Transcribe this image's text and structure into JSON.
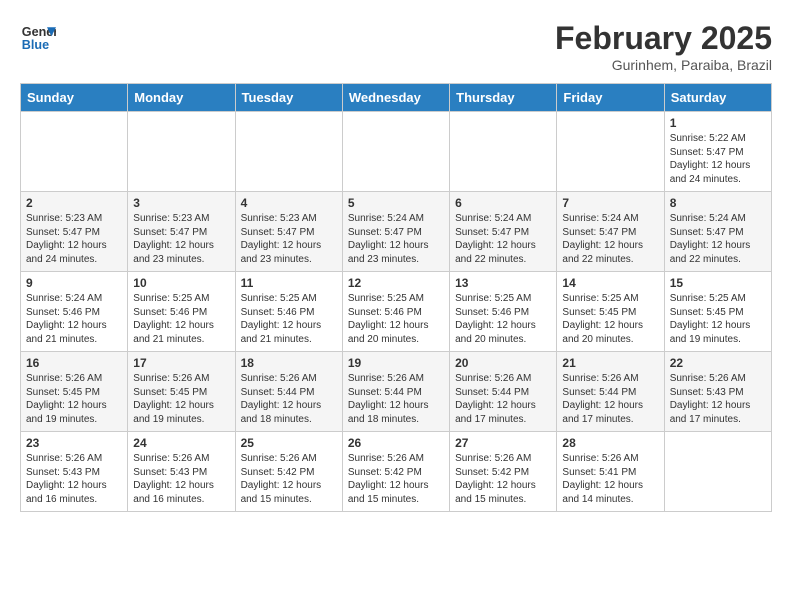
{
  "header": {
    "logo_general": "General",
    "logo_blue": "Blue",
    "month_title": "February 2025",
    "subtitle": "Gurinhem, Paraiba, Brazil"
  },
  "weekdays": [
    "Sunday",
    "Monday",
    "Tuesday",
    "Wednesday",
    "Thursday",
    "Friday",
    "Saturday"
  ],
  "weeks": [
    [
      {
        "day": "",
        "info": ""
      },
      {
        "day": "",
        "info": ""
      },
      {
        "day": "",
        "info": ""
      },
      {
        "day": "",
        "info": ""
      },
      {
        "day": "",
        "info": ""
      },
      {
        "day": "",
        "info": ""
      },
      {
        "day": "1",
        "info": "Sunrise: 5:22 AM\nSunset: 5:47 PM\nDaylight: 12 hours\nand 24 minutes."
      }
    ],
    [
      {
        "day": "2",
        "info": "Sunrise: 5:23 AM\nSunset: 5:47 PM\nDaylight: 12 hours\nand 24 minutes."
      },
      {
        "day": "3",
        "info": "Sunrise: 5:23 AM\nSunset: 5:47 PM\nDaylight: 12 hours\nand 23 minutes."
      },
      {
        "day": "4",
        "info": "Sunrise: 5:23 AM\nSunset: 5:47 PM\nDaylight: 12 hours\nand 23 minutes."
      },
      {
        "day": "5",
        "info": "Sunrise: 5:24 AM\nSunset: 5:47 PM\nDaylight: 12 hours\nand 23 minutes."
      },
      {
        "day": "6",
        "info": "Sunrise: 5:24 AM\nSunset: 5:47 PM\nDaylight: 12 hours\nand 22 minutes."
      },
      {
        "day": "7",
        "info": "Sunrise: 5:24 AM\nSunset: 5:47 PM\nDaylight: 12 hours\nand 22 minutes."
      },
      {
        "day": "8",
        "info": "Sunrise: 5:24 AM\nSunset: 5:47 PM\nDaylight: 12 hours\nand 22 minutes."
      }
    ],
    [
      {
        "day": "9",
        "info": "Sunrise: 5:24 AM\nSunset: 5:46 PM\nDaylight: 12 hours\nand 21 minutes."
      },
      {
        "day": "10",
        "info": "Sunrise: 5:25 AM\nSunset: 5:46 PM\nDaylight: 12 hours\nand 21 minutes."
      },
      {
        "day": "11",
        "info": "Sunrise: 5:25 AM\nSunset: 5:46 PM\nDaylight: 12 hours\nand 21 minutes."
      },
      {
        "day": "12",
        "info": "Sunrise: 5:25 AM\nSunset: 5:46 PM\nDaylight: 12 hours\nand 20 minutes."
      },
      {
        "day": "13",
        "info": "Sunrise: 5:25 AM\nSunset: 5:46 PM\nDaylight: 12 hours\nand 20 minutes."
      },
      {
        "day": "14",
        "info": "Sunrise: 5:25 AM\nSunset: 5:45 PM\nDaylight: 12 hours\nand 20 minutes."
      },
      {
        "day": "15",
        "info": "Sunrise: 5:25 AM\nSunset: 5:45 PM\nDaylight: 12 hours\nand 19 minutes."
      }
    ],
    [
      {
        "day": "16",
        "info": "Sunrise: 5:26 AM\nSunset: 5:45 PM\nDaylight: 12 hours\nand 19 minutes."
      },
      {
        "day": "17",
        "info": "Sunrise: 5:26 AM\nSunset: 5:45 PM\nDaylight: 12 hours\nand 19 minutes."
      },
      {
        "day": "18",
        "info": "Sunrise: 5:26 AM\nSunset: 5:44 PM\nDaylight: 12 hours\nand 18 minutes."
      },
      {
        "day": "19",
        "info": "Sunrise: 5:26 AM\nSunset: 5:44 PM\nDaylight: 12 hours\nand 18 minutes."
      },
      {
        "day": "20",
        "info": "Sunrise: 5:26 AM\nSunset: 5:44 PM\nDaylight: 12 hours\nand 17 minutes."
      },
      {
        "day": "21",
        "info": "Sunrise: 5:26 AM\nSunset: 5:44 PM\nDaylight: 12 hours\nand 17 minutes."
      },
      {
        "day": "22",
        "info": "Sunrise: 5:26 AM\nSunset: 5:43 PM\nDaylight: 12 hours\nand 17 minutes."
      }
    ],
    [
      {
        "day": "23",
        "info": "Sunrise: 5:26 AM\nSunset: 5:43 PM\nDaylight: 12 hours\nand 16 minutes."
      },
      {
        "day": "24",
        "info": "Sunrise: 5:26 AM\nSunset: 5:43 PM\nDaylight: 12 hours\nand 16 minutes."
      },
      {
        "day": "25",
        "info": "Sunrise: 5:26 AM\nSunset: 5:42 PM\nDaylight: 12 hours\nand 15 minutes."
      },
      {
        "day": "26",
        "info": "Sunrise: 5:26 AM\nSunset: 5:42 PM\nDaylight: 12 hours\nand 15 minutes."
      },
      {
        "day": "27",
        "info": "Sunrise: 5:26 AM\nSunset: 5:42 PM\nDaylight: 12 hours\nand 15 minutes."
      },
      {
        "day": "28",
        "info": "Sunrise: 5:26 AM\nSunset: 5:41 PM\nDaylight: 12 hours\nand 14 minutes."
      },
      {
        "day": "",
        "info": ""
      }
    ]
  ]
}
